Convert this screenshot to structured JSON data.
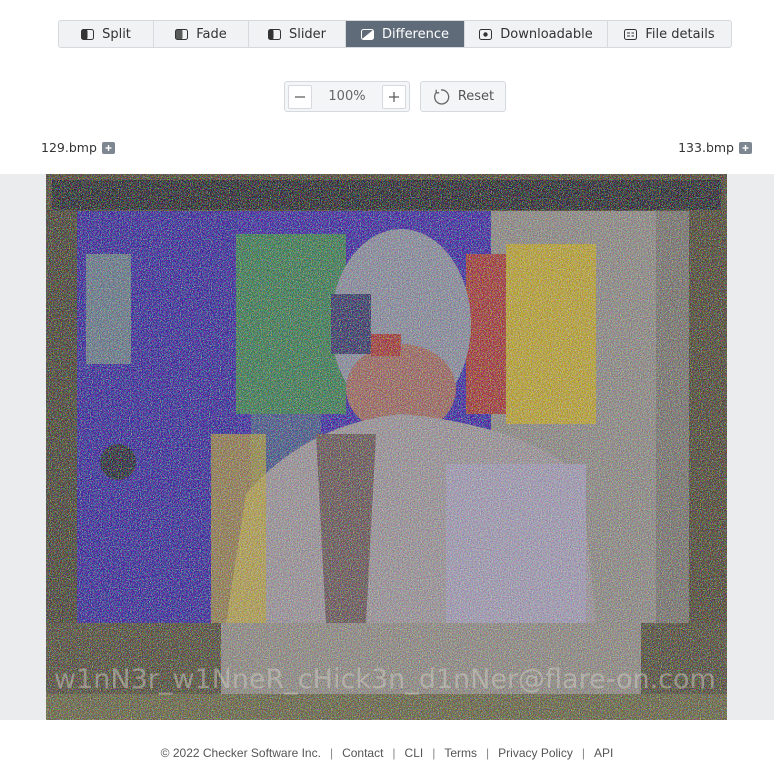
{
  "tabs": [
    {
      "label": "Split",
      "icon": "split-icon",
      "active": false
    },
    {
      "label": "Fade",
      "icon": "fade-icon",
      "active": false
    },
    {
      "label": "Slider",
      "icon": "slider-icon",
      "active": false
    },
    {
      "label": "Difference",
      "icon": "difference-icon",
      "active": true
    },
    {
      "label": "Downloadable",
      "icon": "downloadable-icon",
      "active": false
    },
    {
      "label": "File details",
      "icon": "file-details-icon",
      "active": false
    }
  ],
  "zoom": {
    "level": "100%",
    "minus_icon": "minus-icon",
    "plus_icon": "plus-icon"
  },
  "reset": {
    "label": "Reset",
    "icon": "reset-icon"
  },
  "files": {
    "left": "129.bmp",
    "right": "133.bmp"
  },
  "image": {
    "overlay_text": "w1nN3r_w1NneR_cHick3n_d1nNer@flare-on.com",
    "colors": {
      "bg": "#514a36",
      "frame": "#1e1f28",
      "purple": "#3f2aa0",
      "green": "#3f7c55",
      "yellow": "#b6a134",
      "red": "#a03c38",
      "gray": "#8e8a86"
    }
  },
  "footer": {
    "copyright": "© 2022 Checker Software Inc.",
    "links": [
      "Contact",
      "CLI",
      "Terms",
      "Privacy Policy",
      "API"
    ]
  },
  "colors": {
    "active_tab": "#5f6b78",
    "viewer_bg": "#ebecee",
    "border": "#d6d9de"
  }
}
